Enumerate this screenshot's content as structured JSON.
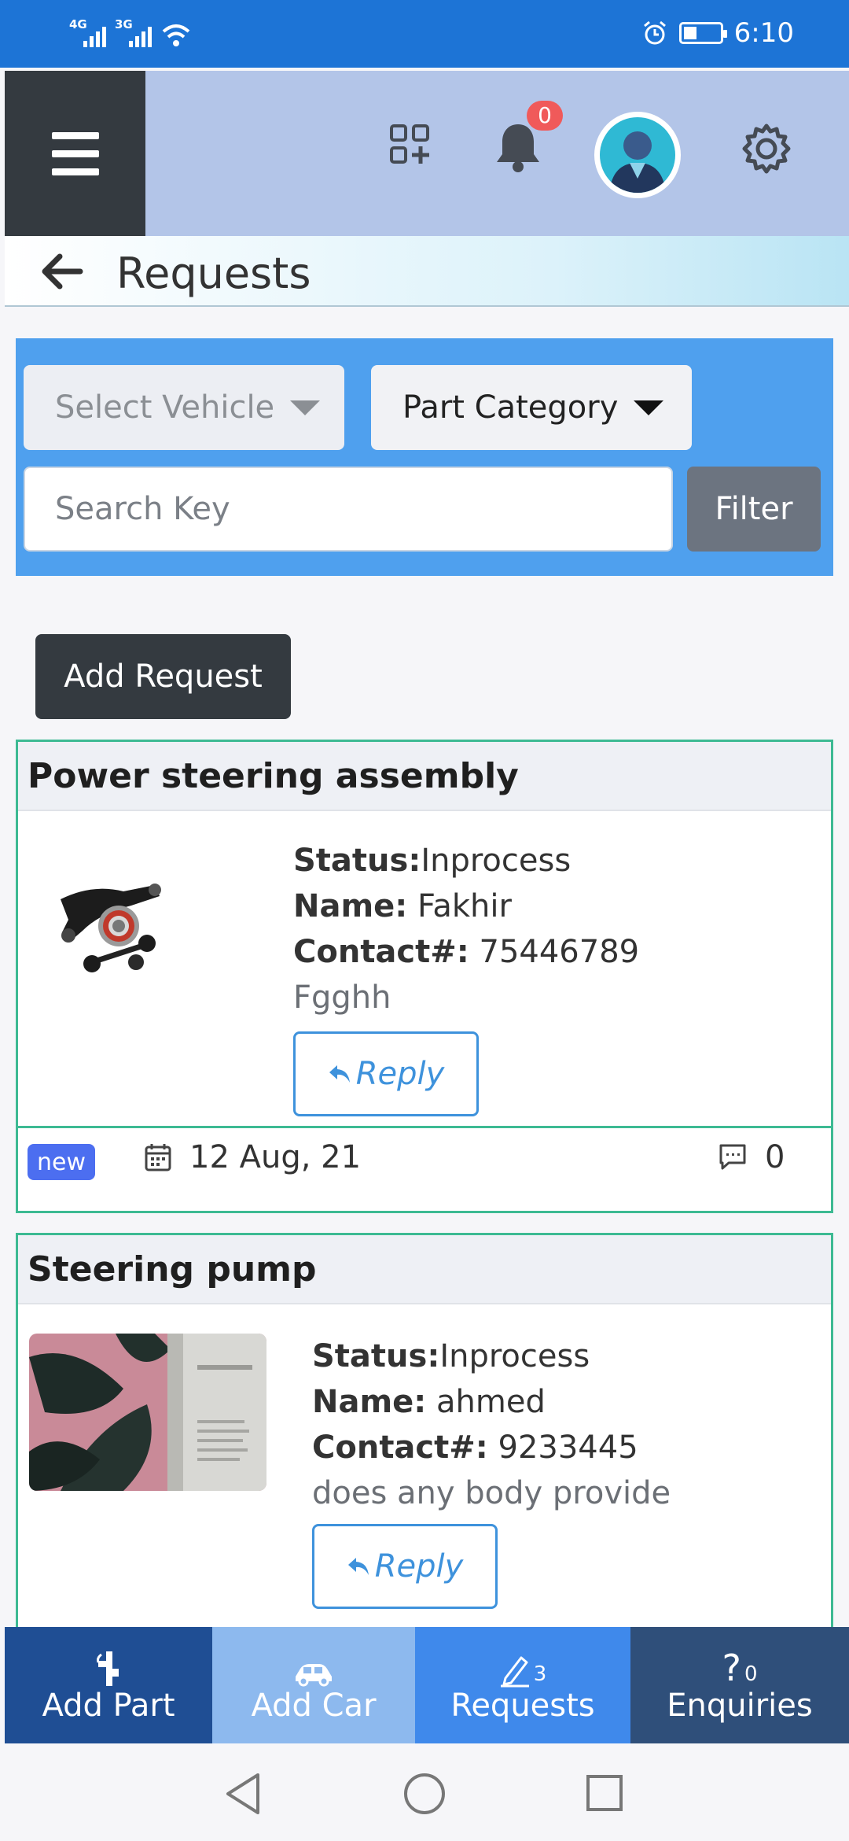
{
  "status_bar": {
    "network1": "4G",
    "network2": "3G",
    "time": "6:10"
  },
  "header": {
    "notification_count": "0",
    "icons": [
      "menu-icon",
      "qr-add-icon",
      "bell-icon",
      "avatar",
      "gear-icon"
    ]
  },
  "page": {
    "title": "Requests"
  },
  "filters": {
    "vehicle_select": "Select Vehicle",
    "part_category": "Part Category",
    "search_placeholder": "Search Key",
    "filter_button": "Filter"
  },
  "add_request_label": "Add Request",
  "requests": [
    {
      "title": "Power steering assembly",
      "status_label": "Status:",
      "status": "Inprocess",
      "name_label": "Name:",
      "name": "Fakhir",
      "contact_label": "Contact#:",
      "contact": "75446789",
      "description": "Fgghh",
      "reply_label": "Reply",
      "badge": "new",
      "date": "12 Aug, 21",
      "comments": "0"
    },
    {
      "title": "Steering pump",
      "status_label": "Status:",
      "status": "Inprocess",
      "name_label": "Name:",
      "name": "ahmed",
      "contact_label": "Contact#:",
      "contact": "9233445",
      "description": "does any body provide",
      "reply_label": "Reply"
    }
  ],
  "bottom_nav": [
    {
      "label": "Add Part",
      "icon": "part-icon"
    },
    {
      "label": "Add Car",
      "icon": "car-icon"
    },
    {
      "label": "Requests",
      "icon": "pencil-icon",
      "count": "3"
    },
    {
      "label": "Enquiries",
      "icon": "question-icon",
      "count": "0"
    }
  ],
  "colors": {
    "status_bar": "#1d74d6",
    "header_bg": "#b3c5e8",
    "filter_panel": "#4fa0ee",
    "card_border": "#3dba93",
    "dark_button": "#343a40",
    "reply_blue": "#3e92dc",
    "badge_new": "#4c6ef0",
    "notification_badge": "#f05a5a"
  }
}
